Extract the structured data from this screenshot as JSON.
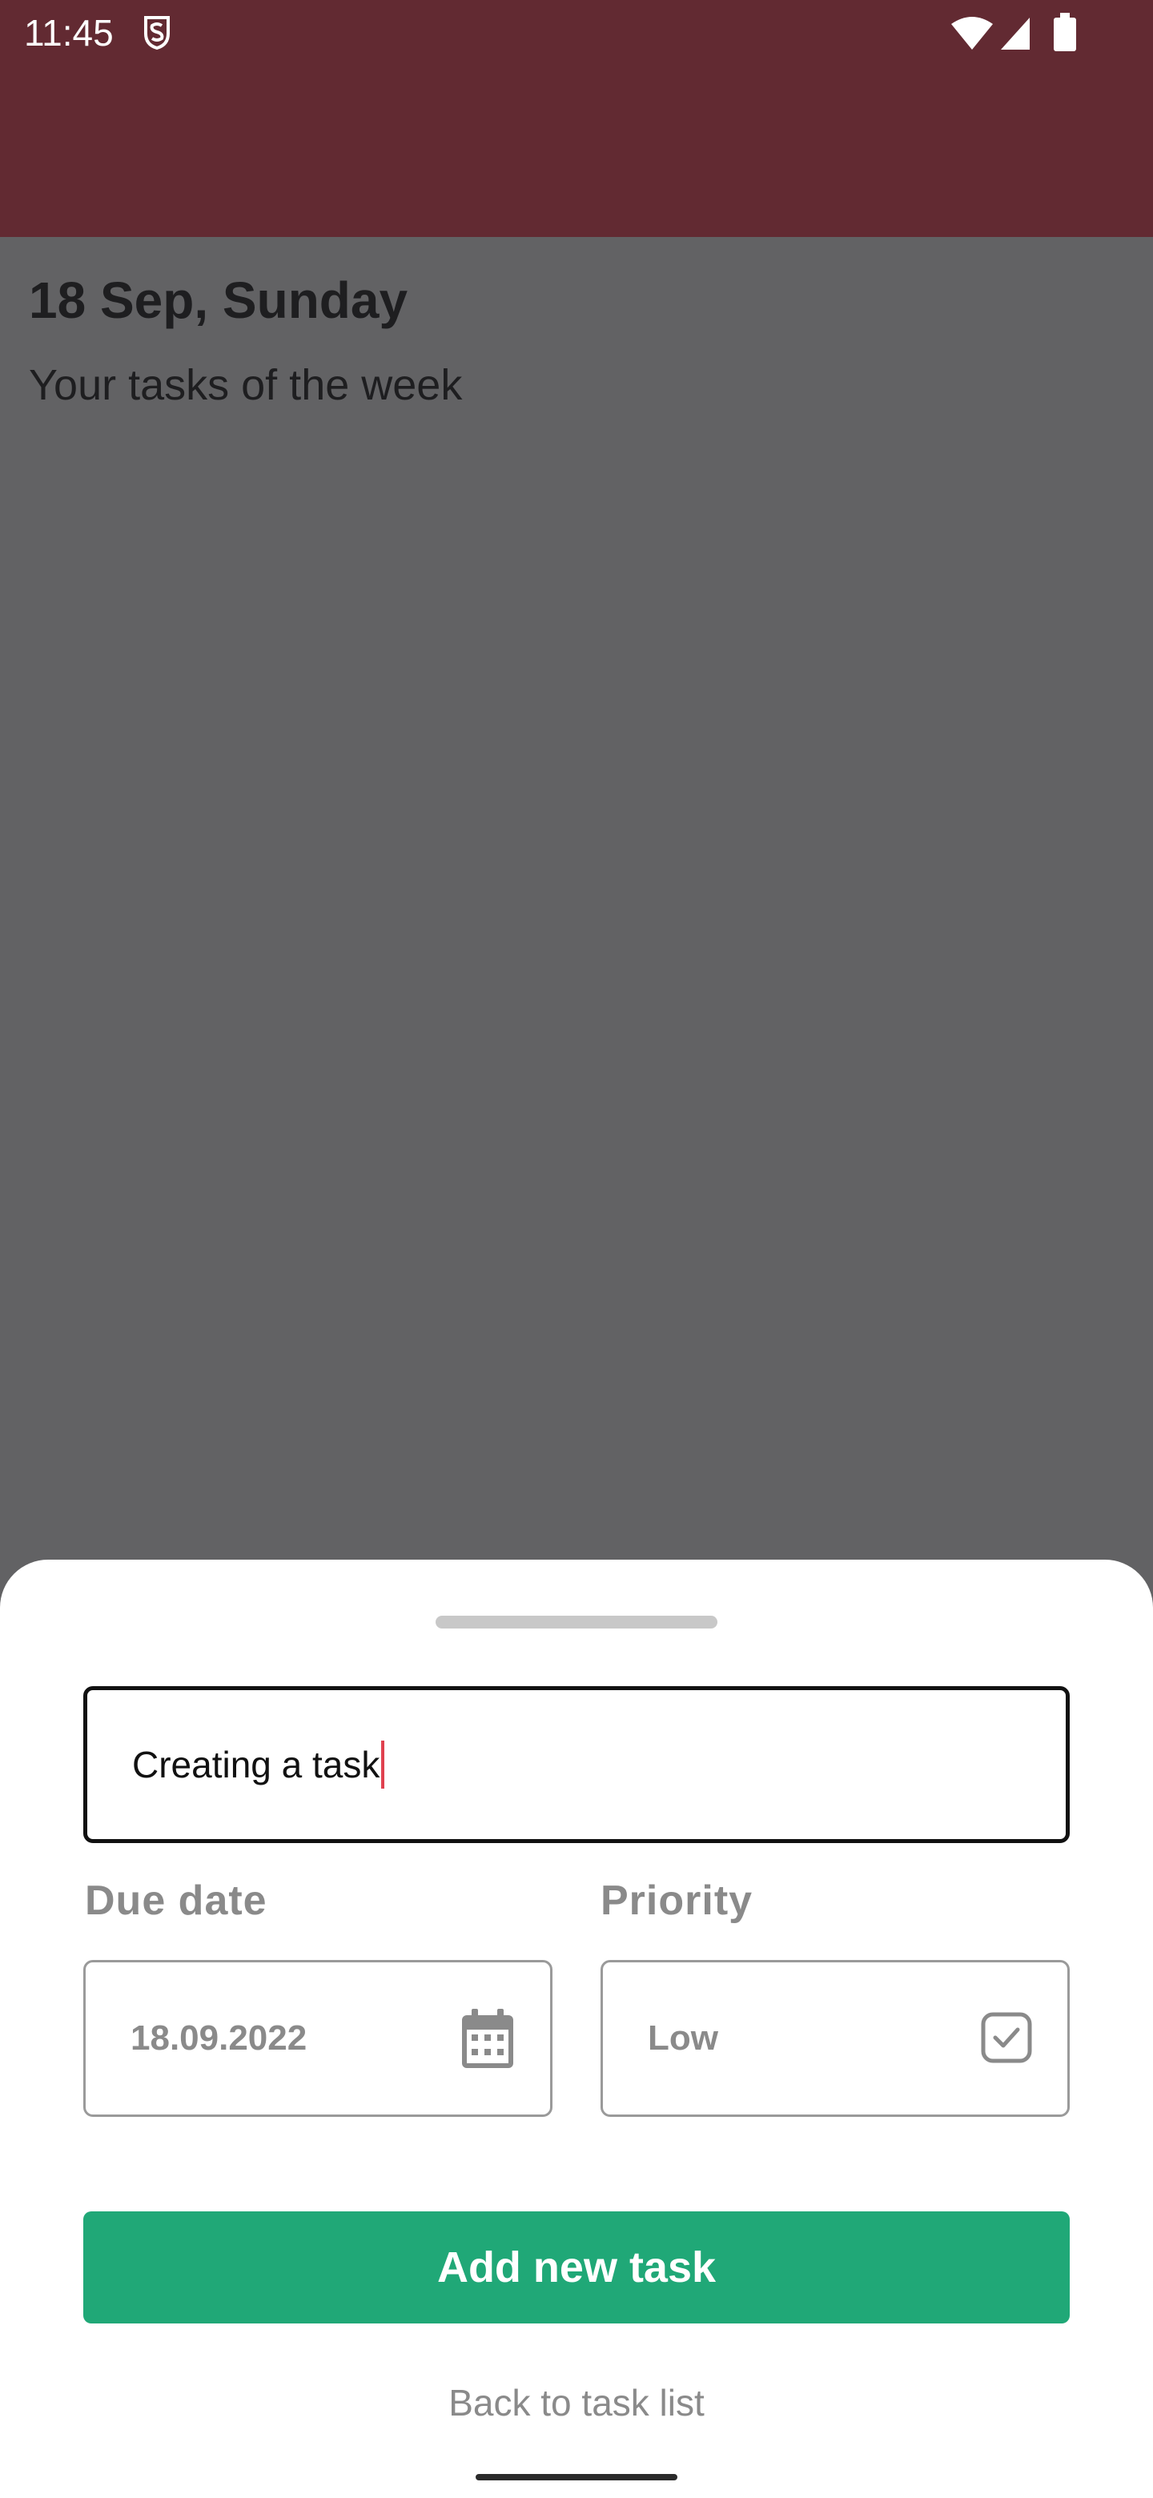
{
  "status_bar": {
    "time": "11:45",
    "icons": [
      "shield-s-icon",
      "wifi-icon",
      "signal-icon",
      "battery-icon"
    ],
    "color": "#622a32"
  },
  "header": {
    "date": "18 Sep, Sunday",
    "subtitle": "Your tasks of the week"
  },
  "sheet": {
    "task_input_value": "Creating a task",
    "due_date": {
      "label": "Due date",
      "value": "18.09.2022",
      "icon": "calendar-icon"
    },
    "priority": {
      "label": "Priority",
      "value": "Low",
      "icon": "checkbox-icon"
    },
    "add_button_label": "Add new task",
    "back_link_label": "Back to task list",
    "accent_color": "#20a877"
  }
}
